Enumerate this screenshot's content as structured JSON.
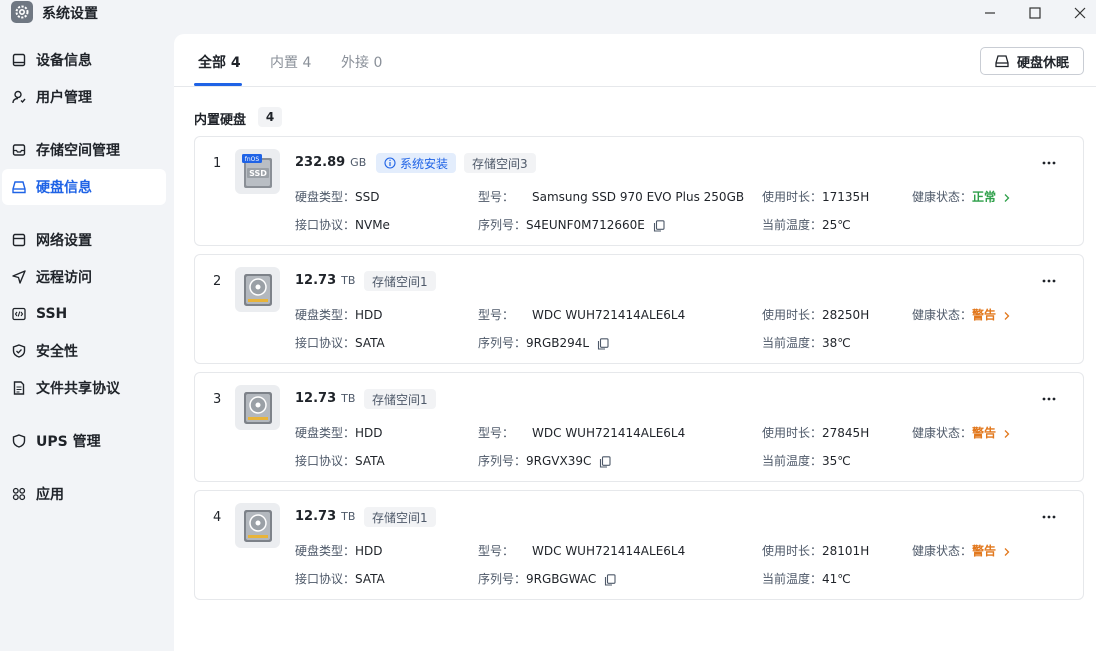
{
  "window": {
    "title": "系统设置"
  },
  "sidebar": {
    "items": [
      {
        "label": "设备信息",
        "icon": "device-icon"
      },
      {
        "label": "用户管理",
        "icon": "user-icon"
      },
      {
        "label": "存储空间管理",
        "icon": "storage-icon"
      },
      {
        "label": "硬盘信息",
        "icon": "disk-icon",
        "active": true
      },
      {
        "label": "网络设置",
        "icon": "network-icon"
      },
      {
        "label": "远程访问",
        "icon": "remote-icon"
      },
      {
        "label": "SSH",
        "icon": "code-icon"
      },
      {
        "label": "安全性",
        "icon": "shield-icon"
      },
      {
        "label": "文件共享协议",
        "icon": "file-icon"
      },
      {
        "label": "UPS 管理",
        "icon": "ups-icon"
      },
      {
        "label": "应用",
        "icon": "apps-icon"
      }
    ]
  },
  "tabs": [
    {
      "label": "全部 4",
      "active": true
    },
    {
      "label": "内置 4"
    },
    {
      "label": "外接 0"
    }
  ],
  "sleep_button": "硬盘休眠",
  "section": {
    "title": "内置硬盘",
    "count": "4"
  },
  "labels": {
    "disk_type": "硬盘类型：",
    "model": "型号：",
    "usage": "使用时长：",
    "health": "健康状态：",
    "interface": "接口协议：",
    "serial": "序列号：",
    "temperature": "当前温度："
  },
  "disks": [
    {
      "index": "1",
      "capacity": "232.89",
      "unit": "GB",
      "badges": [
        "系统安装",
        "存储空间3"
      ],
      "type": "SSD",
      "model": "Samsung SSD 970 EVO Plus 250GB",
      "usage": "17135H",
      "health": "正常",
      "interface": "NVMe",
      "serial": "S4EUNF0M712660E",
      "temperature": "25℃",
      "icon_text": "SSD",
      "icon_tag": "fnOS"
    },
    {
      "index": "2",
      "capacity": "12.73",
      "unit": "TB",
      "badges": [
        "存储空间1"
      ],
      "type": "HDD",
      "model": "WDC WUH721414ALE6L4",
      "usage": "28250H",
      "health": "警告",
      "interface": "SATA",
      "serial": "9RGB294L",
      "temperature": "38℃"
    },
    {
      "index": "3",
      "capacity": "12.73",
      "unit": "TB",
      "badges": [
        "存储空间1"
      ],
      "type": "HDD",
      "model": "WDC WUH721414ALE6L4",
      "usage": "27845H",
      "health": "警告",
      "interface": "SATA",
      "serial": "9RGVX39C",
      "temperature": "35℃"
    },
    {
      "index": "4",
      "capacity": "12.73",
      "unit": "TB",
      "badges": [
        "存储空间1"
      ],
      "type": "HDD",
      "model": "WDC WUH721414ALE6L4",
      "usage": "28101H",
      "health": "警告",
      "interface": "SATA",
      "serial": "9RGBGWAC",
      "temperature": "41℃"
    }
  ],
  "colors": {
    "accent": "#1f63e6",
    "health_ok": "#2fa04a",
    "health_warn": "#e2781d"
  }
}
